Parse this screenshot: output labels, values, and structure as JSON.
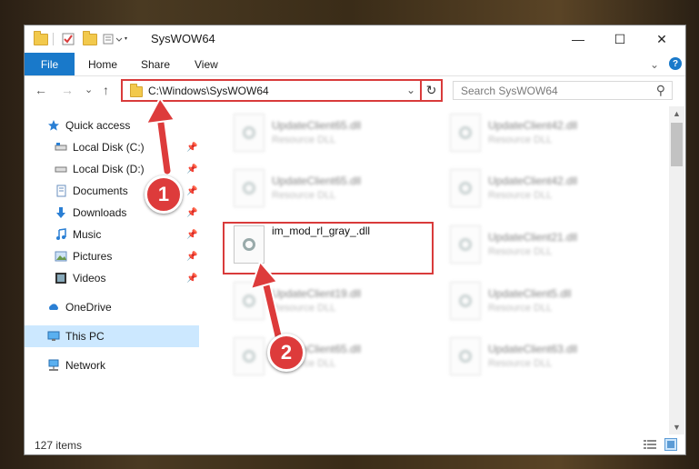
{
  "window": {
    "title": "SysWOW64",
    "min_glyph": "—",
    "max_glyph": "☐",
    "close_glyph": "✕"
  },
  "ribbon": {
    "tabs": [
      "File",
      "Home",
      "Share",
      "View"
    ],
    "expand_glyph": "⌄",
    "help_glyph": "?"
  },
  "nav": {
    "back_glyph": "←",
    "forward_glyph": "→",
    "recent_glyph": "⌄",
    "up_glyph": "↑"
  },
  "address": {
    "path": "C:\\Windows\\SysWOW64",
    "dropdown_glyph": "⌄",
    "refresh_glyph": "↻"
  },
  "search": {
    "placeholder": "Search SysWOW64",
    "icon_glyph": "⚲"
  },
  "nav_pane": [
    {
      "label": "Quick access",
      "icon": "star-icon"
    },
    {
      "label": "Local Disk (C:)",
      "icon": "drive-icon",
      "pinned": true
    },
    {
      "label": "Local Disk (D:)",
      "icon": "drive-icon",
      "pinned": true
    },
    {
      "label": "Documents",
      "icon": "documents-icon",
      "pinned": true
    },
    {
      "label": "Downloads",
      "icon": "downloads-icon",
      "pinned": true
    },
    {
      "label": "Music",
      "icon": "music-icon",
      "pinned": true
    },
    {
      "label": "Pictures",
      "icon": "pictures-icon",
      "pinned": true
    },
    {
      "label": "Videos",
      "icon": "videos-icon",
      "pinned": true
    },
    {
      "label": "OneDrive",
      "icon": "cloud-icon"
    },
    {
      "label": "This PC",
      "icon": "computer-icon",
      "selected": true
    },
    {
      "label": "Network",
      "icon": "network-icon"
    }
  ],
  "files": [
    {
      "name": "UpdateClient65.dll",
      "type": "Resource DLL"
    },
    {
      "name": "UpdateClient42.dll",
      "type": "Resource DLL"
    },
    {
      "name": "UpdateClient65.dll",
      "type": "Resource DLL"
    },
    {
      "name": "UpdateClient42.dll",
      "type": "Resource DLL"
    },
    {
      "name": "im_mod_rl_gray_.dll",
      "type": ""
    },
    {
      "name": "UpdateClient21.dll",
      "type": "Resource DLL"
    },
    {
      "name": "UpdateClient19.dll",
      "type": "Resource DLL"
    },
    {
      "name": "UpdateClient5.dll",
      "type": "Resource DLL"
    },
    {
      "name": "UpdateClient65.dll",
      "type": "Resource DLL"
    },
    {
      "name": "UpdateClient63.dll",
      "type": "Resource DLL"
    }
  ],
  "status": {
    "count": "127 items"
  },
  "annotations": [
    "1",
    "2"
  ],
  "colors": {
    "accent": "#1979ca",
    "highlight": "#d93b3b",
    "selected_bg": "#cce8ff"
  }
}
